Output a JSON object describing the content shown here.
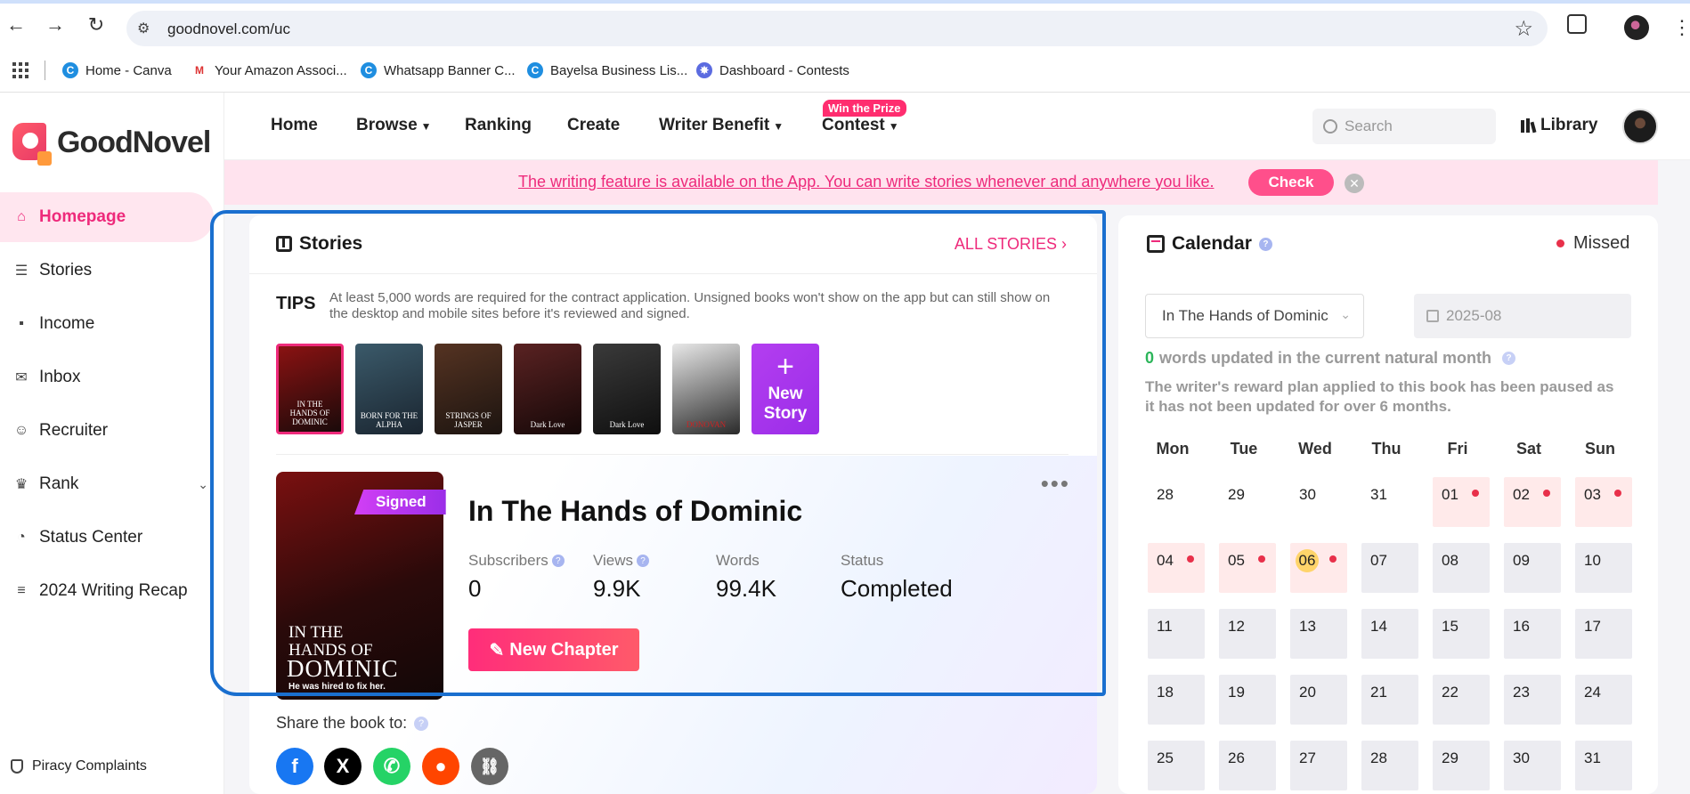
{
  "browser": {
    "url": "goodnovel.com/uc",
    "bookmarks": [
      {
        "label": "Home - Canva",
        "color": "#1f8ee0",
        "glyph": "C"
      },
      {
        "label": "Your Amazon Associ...",
        "color": "#d33",
        "glyph": "M"
      },
      {
        "label": "Whatsapp Banner C...",
        "color": "#1f8ee0",
        "glyph": "C"
      },
      {
        "label": "Bayelsa Business Lis...",
        "color": "#1f8ee0",
        "glyph": "C"
      },
      {
        "label": "Dashboard - Contests",
        "color": "#5b6be0",
        "glyph": "✸"
      }
    ]
  },
  "brand": {
    "name": "GoodNovel"
  },
  "sidebar": {
    "items": [
      {
        "label": "Homepage",
        "icon": "home-icon",
        "glyph": "⌂"
      },
      {
        "label": "Stories",
        "icon": "stories-icon",
        "glyph": "☰"
      },
      {
        "label": "Income",
        "icon": "wallet-icon",
        "glyph": "▪"
      },
      {
        "label": "Inbox",
        "icon": "inbox-icon",
        "glyph": "✉"
      },
      {
        "label": "Recruiter",
        "icon": "people-icon",
        "glyph": "☺"
      },
      {
        "label": "Rank",
        "icon": "trophy-icon",
        "glyph": "♛"
      },
      {
        "label": "Status Center",
        "icon": "status-icon",
        "glyph": "◔"
      },
      {
        "label": "2024 Writing Recap",
        "icon": "recap-icon",
        "glyph": "≡"
      }
    ],
    "piracy": "Piracy Complaints"
  },
  "topnav": {
    "home": "Home",
    "browse": "Browse",
    "ranking": "Ranking",
    "create": "Create",
    "writer_benefit": "Writer Benefit",
    "contest": "Contest",
    "prize_badge": "Win the Prize",
    "search_placeholder": "Search",
    "library": "Library"
  },
  "banner": {
    "text": "The writing feature is available on the App. You can write stories whenever and anywhere you like.",
    "check": "Check"
  },
  "stories": {
    "title": "Stories",
    "all": "ALL STORIES",
    "tips_label": "TIPS",
    "tips_text": "At least 5,000 words are required for the contract application. Unsigned books won't show on the app but can still show on the desktop and mobile sites before it's reviewed and signed.",
    "thumbnails": [
      {
        "caption": "IN THE HANDS OF DOMINIC",
        "bg": "linear-gradient(160deg,#8a1212,#1a0a0a)"
      },
      {
        "caption": "BORN FOR THE ALPHA",
        "bg": "linear-gradient(160deg,#3b5a6a,#1a2530)"
      },
      {
        "caption": "STRINGS OF JASPER",
        "bg": "linear-gradient(160deg,#553322,#1c1410)"
      },
      {
        "caption": "Dark Love",
        "bg": "linear-gradient(160deg,#5a2222,#150808)"
      },
      {
        "caption": "Dark Love",
        "bg": "linear-gradient(160deg,#3a3a3a,#0f0f0f)"
      },
      {
        "caption": "DONOVAN",
        "bg": "linear-gradient(160deg,#e8e8e8,#2a2a2a)"
      }
    ],
    "new_story_line1": "New",
    "new_story_line2": "Story"
  },
  "featured": {
    "status_badge": "Signed",
    "cover_line1": "IN THE",
    "cover_line2": "HANDS OF",
    "cover_line3": "DOMINIC",
    "cover_tagline": "He was hired to fix her.",
    "title": "In The Hands of Dominic",
    "stats": [
      {
        "label": "Subscribers",
        "value": "0",
        "help": true
      },
      {
        "label": "Views",
        "value": "9.9K",
        "help": true
      },
      {
        "label": "Words",
        "value": "99.4K",
        "help": false
      },
      {
        "label": "Status",
        "value": "Completed",
        "help": false
      }
    ],
    "new_chapter": "New Chapter",
    "share_label": "Share the book to:"
  },
  "calendar": {
    "title": "Calendar",
    "legend_missed": "Missed",
    "book_select": "In The Hands of Dominic",
    "month": "2025-08",
    "words_count": "0",
    "words_text": "words updated in the current natural month",
    "reward_note": "The writer's reward plan applied to this book has been paused as it has not been updated for over 6 months.",
    "weekdays": [
      "Mon",
      "Tue",
      "Wed",
      "Thu",
      "Fri",
      "Sat",
      "Sun"
    ],
    "days": [
      {
        "n": "28",
        "state": "other"
      },
      {
        "n": "29",
        "state": "other"
      },
      {
        "n": "30",
        "state": "other"
      },
      {
        "n": "31",
        "state": "other"
      },
      {
        "n": "01",
        "state": "missed"
      },
      {
        "n": "02",
        "state": "missed"
      },
      {
        "n": "03",
        "state": "missed"
      },
      {
        "n": "04",
        "state": "missed"
      },
      {
        "n": "05",
        "state": "missed"
      },
      {
        "n": "06",
        "state": "today"
      },
      {
        "n": "07",
        "state": "future"
      },
      {
        "n": "08",
        "state": "future"
      },
      {
        "n": "09",
        "state": "future"
      },
      {
        "n": "10",
        "state": "future"
      },
      {
        "n": "11",
        "state": "future"
      },
      {
        "n": "12",
        "state": "future"
      },
      {
        "n": "13",
        "state": "future"
      },
      {
        "n": "14",
        "state": "future"
      },
      {
        "n": "15",
        "state": "future"
      },
      {
        "n": "16",
        "state": "future"
      },
      {
        "n": "17",
        "state": "future"
      },
      {
        "n": "18",
        "state": "future"
      },
      {
        "n": "19",
        "state": "future"
      },
      {
        "n": "20",
        "state": "future"
      },
      {
        "n": "21",
        "state": "future"
      },
      {
        "n": "22",
        "state": "future"
      },
      {
        "n": "23",
        "state": "future"
      },
      {
        "n": "24",
        "state": "future"
      },
      {
        "n": "25",
        "state": "future"
      },
      {
        "n": "26",
        "state": "future"
      },
      {
        "n": "27",
        "state": "future"
      },
      {
        "n": "28",
        "state": "future"
      },
      {
        "n": "29",
        "state": "future"
      },
      {
        "n": "30",
        "state": "future"
      },
      {
        "n": "31",
        "state": "future"
      }
    ]
  },
  "colors": {
    "accent": "#ee2a7b",
    "missed": "#e8304a",
    "annotation": "#1a6fcf"
  }
}
